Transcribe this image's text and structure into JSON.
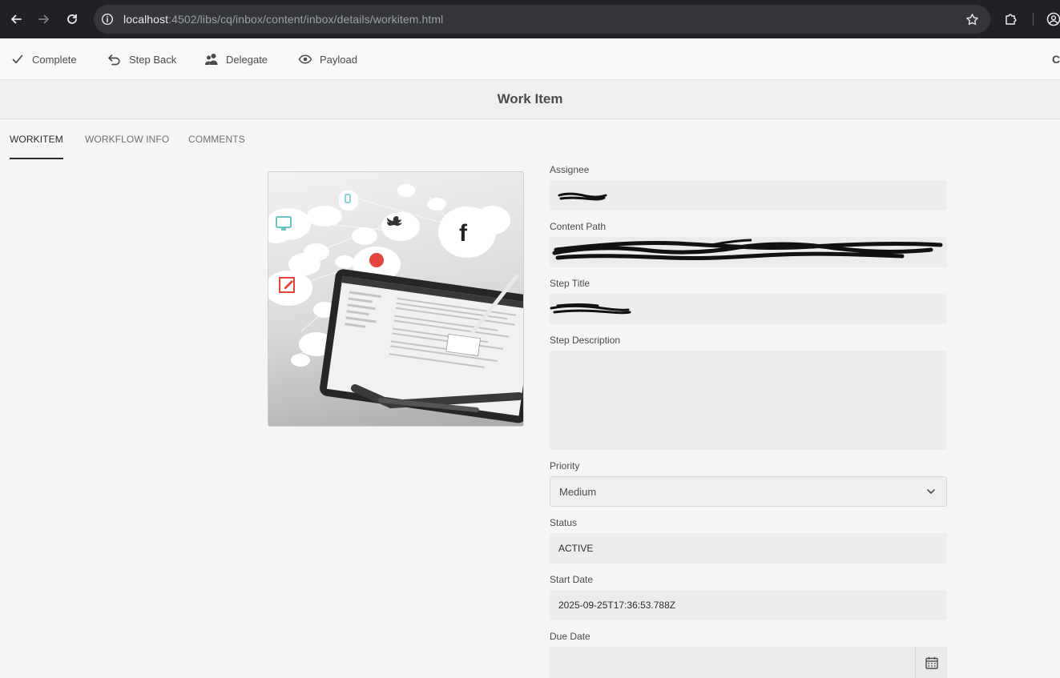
{
  "browser": {
    "url_host": "localhost",
    "url_rest": ":4502/libs/cq/inbox/content/inbox/details/workitem.html"
  },
  "actions": {
    "complete": "Complete",
    "step_back": "Step Back",
    "delegate": "Delegate",
    "payload": "Payload",
    "close": "Cl"
  },
  "header": {
    "title": "Work Item"
  },
  "tabs": [
    {
      "label": "WORKITEM",
      "active": true
    },
    {
      "label": "WORKFLOW INFO",
      "active": false
    },
    {
      "label": "COMMENTS",
      "active": false
    }
  ],
  "form": {
    "assignee": {
      "label": "Assignee",
      "value": ""
    },
    "content_path": {
      "label": "Content Path",
      "value": ""
    },
    "step_title": {
      "label": "Step Title",
      "value": ""
    },
    "step_description": {
      "label": "Step Description",
      "value": ""
    },
    "priority": {
      "label": "Priority",
      "value": "Medium"
    },
    "status": {
      "label": "Status",
      "value": "ACTIVE"
    },
    "start_date": {
      "label": "Start Date",
      "value": "2025-09-25T17:36:53.788Z"
    },
    "due_date": {
      "label": "Due Date",
      "value": ""
    }
  },
  "icons": {
    "back": "arrow-left-icon",
    "forward": "arrow-right-icon",
    "reload": "reload-icon",
    "site_info": "info-icon",
    "bookmark": "star-icon",
    "extensions": "puzzle-icon",
    "profile": "profile-icon",
    "complete": "checkmark-icon",
    "step_back": "undo-icon",
    "delegate": "users-icon",
    "payload": "eye-icon",
    "priority_dropdown": "chevron-down-icon",
    "due_date_picker": "calendar-icon"
  },
  "colors": {
    "browser_bar": "#202124",
    "omnibox": "#35363a",
    "page_background": "#f5f5f5",
    "field_background": "#ececec",
    "active_tab_underline": "#2c2c2c"
  }
}
